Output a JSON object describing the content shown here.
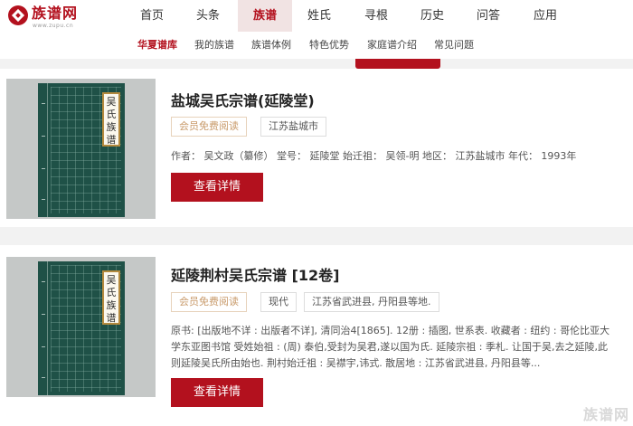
{
  "logo": {
    "name": "族谱网",
    "domain": "www.zupu.cn"
  },
  "nav": [
    {
      "label": "首页"
    },
    {
      "label": "头条"
    },
    {
      "label": "族谱"
    },
    {
      "label": "姓氏"
    },
    {
      "label": "寻根"
    },
    {
      "label": "历史"
    },
    {
      "label": "问答"
    },
    {
      "label": "应用"
    }
  ],
  "subnav": [
    {
      "label": "华夏谱库"
    },
    {
      "label": "我的族谱"
    },
    {
      "label": "族谱体例"
    },
    {
      "label": "特色优势"
    },
    {
      "label": "家庭谱介绍"
    },
    {
      "label": "常见问题"
    }
  ],
  "cover_label": "吴氏族谱",
  "cards": [
    {
      "title": "盐城吴氏宗谱(延陵堂)",
      "tags": [
        "会员免费阅读",
        "江苏盐城市"
      ],
      "meta": "作者：  吴文政（纂修） 堂号：  延陵堂 始迁祖：  吴领-明 地区：  江苏盐城市 年代：  1993年",
      "button": "查看详情"
    },
    {
      "title": "延陵荆村吴氏宗谱 [12卷]",
      "tags": [
        "会员免费阅读",
        "现代",
        "江苏省武进县, 丹阳县等地."
      ],
      "desc": "原书: [出版地不详 : 出版者不详], 清同治4[1865]. 12册 : 插图, 世系表. 收藏者 : 纽约 : 哥伦比亚大学东亚图书馆 受姓始祖 : (周) 泰伯,受封为吴君,遂以国为氏. 延陵宗祖 : 季札. 让国于吴,去之延陵,此则延陵吴氏所由始也. 荆村始迁祖 : 吴襟宇,讳式. 散居地 : 江苏省武进县, 丹阳县等...",
      "button": "查看详情"
    }
  ],
  "watermark": "族谱网",
  "colors": {
    "brand": "#b3111e",
    "member_tag": "#c99b6b",
    "cover": "#1f5147"
  }
}
